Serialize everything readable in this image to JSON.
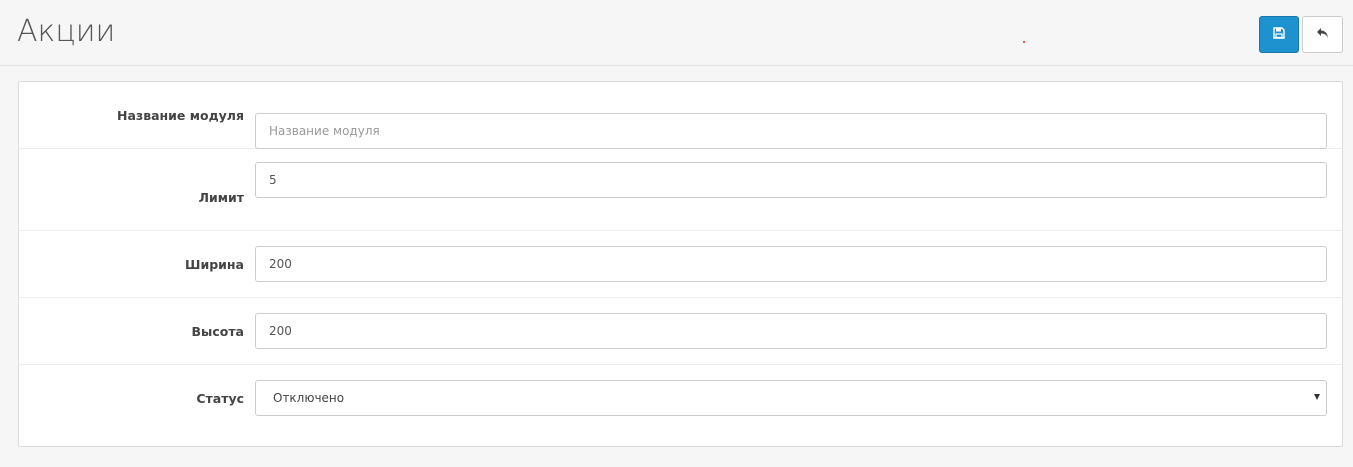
{
  "header": {
    "title": "Акции",
    "save_icon": "save-icon",
    "back_icon": "reply-icon",
    "accent_color": "#1e91cf"
  },
  "form": {
    "module_name": {
      "label": "Название модуля",
      "value": "",
      "placeholder": "Название модуля"
    },
    "limit": {
      "label": "Лимит",
      "value": "5",
      "placeholder": ""
    },
    "width": {
      "label": "Ширина",
      "value": "200",
      "placeholder": ""
    },
    "height": {
      "label": "Высота",
      "value": "200",
      "placeholder": ""
    },
    "status": {
      "label": "Статус",
      "selected": "Отключено"
    }
  }
}
